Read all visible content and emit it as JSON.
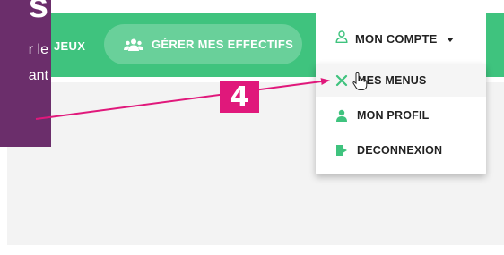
{
  "navbar": {
    "jeux_label": "JEUX",
    "effectifs_label": "GÉRER MES EFFECTIFS",
    "effectifs_icon": "users-icon"
  },
  "account": {
    "label": "MON COMPTE",
    "icon": "user-outline-icon"
  },
  "dropdown": {
    "items": [
      {
        "label": "MES MENUS",
        "icon": "utensils-icon"
      },
      {
        "label": "MON PROFIL",
        "icon": "user-icon"
      },
      {
        "label": "DECONNEXION",
        "icon": "sign-out-icon"
      }
    ]
  },
  "tooltip": {
    "title": "s",
    "line1": "r le",
    "line2": "ant"
  },
  "annotation": {
    "step": "4"
  },
  "colors": {
    "brand_green": "#3fc37e",
    "accent_pink": "#e0187b",
    "tooltip_purple": "#6b2e6b"
  }
}
